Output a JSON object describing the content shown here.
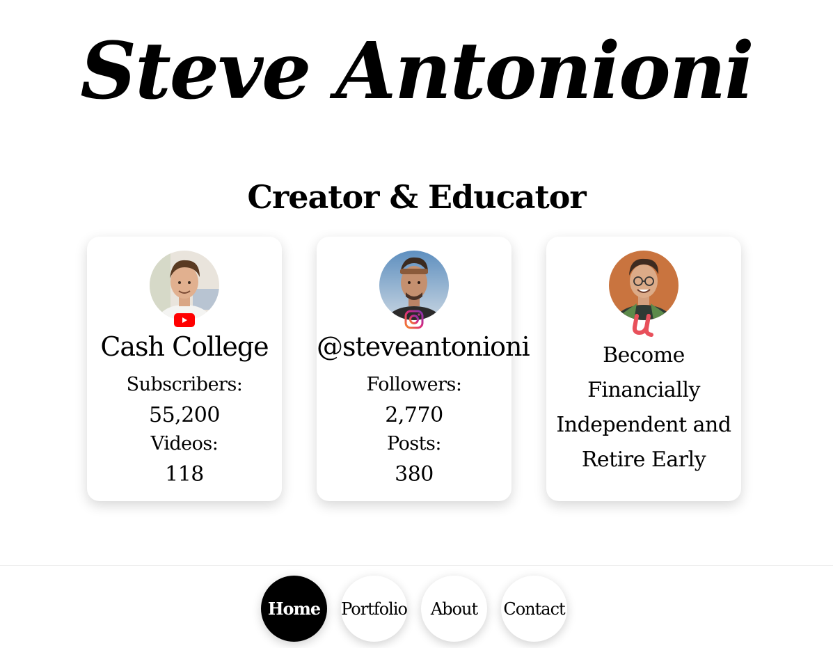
{
  "header": {
    "title": "Steve Antonioni",
    "subtitle": "Creator & Educator"
  },
  "cards": [
    {
      "platform_icon": "youtube-icon",
      "title": "Cash College",
      "stats": [
        {
          "label": "Subscribers:",
          "value": "55,200"
        },
        {
          "label": "Videos:",
          "value": "118"
        }
      ]
    },
    {
      "platform_icon": "instagram-icon",
      "title": "@steveantonioni",
      "stats": [
        {
          "label": "Followers:",
          "value": "2,770"
        },
        {
          "label": "Posts:",
          "value": "380"
        }
      ]
    },
    {
      "platform_icon": "udemy-icon",
      "tagline": "Become Financially Independent and Retire Early"
    }
  ],
  "nav": {
    "items": [
      {
        "label": "Home",
        "active": true
      },
      {
        "label": "Portfolio",
        "active": false
      },
      {
        "label": "About",
        "active": false
      },
      {
        "label": "Contact",
        "active": false
      }
    ]
  },
  "colors": {
    "youtube_red": "#ff0000",
    "instagram_purple": "#c13584",
    "instagram_orange": "#f58529",
    "udemy_red": "#e8505b",
    "active_nav_bg": "#000000"
  }
}
